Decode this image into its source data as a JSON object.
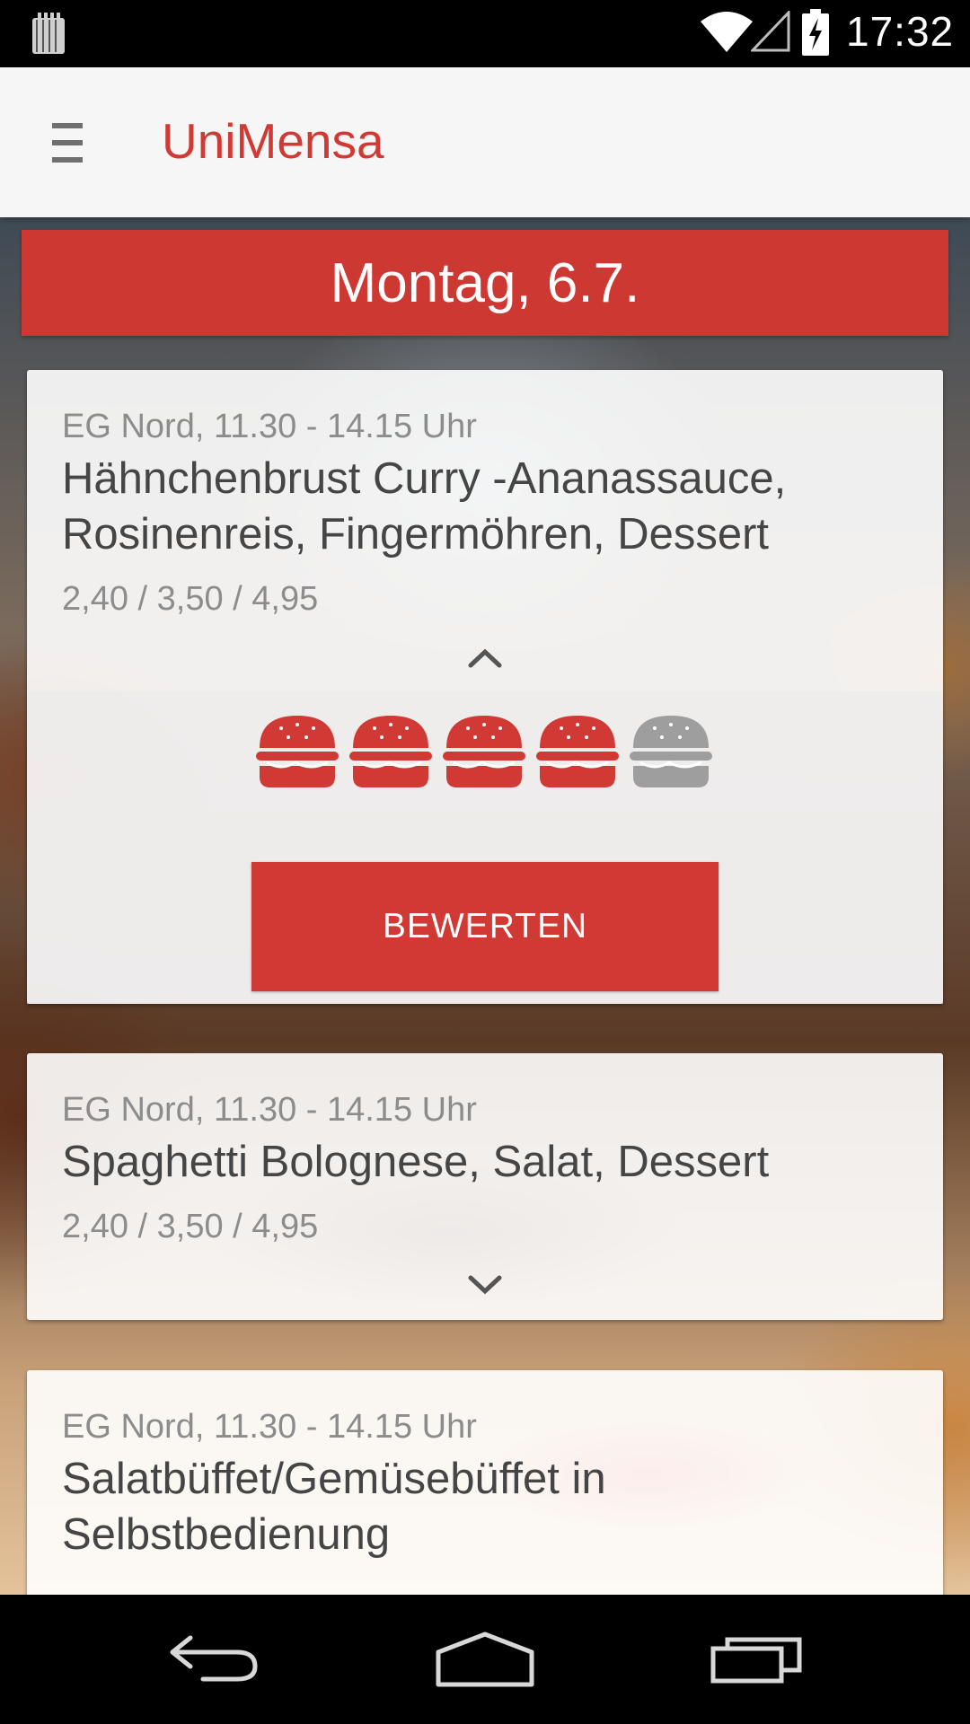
{
  "status_bar": {
    "time": "17:32",
    "icons": [
      "notification-icon",
      "wifi-icon",
      "signal-icon",
      "battery-charging-icon"
    ]
  },
  "app_bar": {
    "menu_icon": "hamburger-menu-icon",
    "title": "UniMensa"
  },
  "day_header": "Montag, 6.7.",
  "meals": [
    {
      "location_time": "EG Nord, 11.30 - 14.15 Uhr",
      "name": "Hähnchenbrust Curry -Ananassauce, Rosinenreis, Fingermöhren, Dessert",
      "prices": "2,40 / 3,50 / 4,95",
      "expanded": true,
      "rating": 4,
      "rating_max": 5,
      "rate_button": "BEWERTEN"
    },
    {
      "location_time": "EG Nord, 11.30 - 14.15 Uhr",
      "name": "Spaghetti Bolognese, Salat, Dessert",
      "prices": "2,40 / 3,50 / 4,95",
      "expanded": false
    },
    {
      "location_time": "EG Nord, 11.30 - 14.15 Uhr",
      "name": "Salatbüffet/Gemüsebüffet in Selbstbedienung",
      "expanded": false
    }
  ],
  "nav_bar": {
    "icons": [
      "back-icon",
      "home-icon",
      "recent-apps-icon"
    ]
  },
  "colors": {
    "accent": "#d03934",
    "rating_active": "#d03934",
    "rating_inactive": "#9e9e9e",
    "app_bar_bg": "#f6f6f6"
  }
}
